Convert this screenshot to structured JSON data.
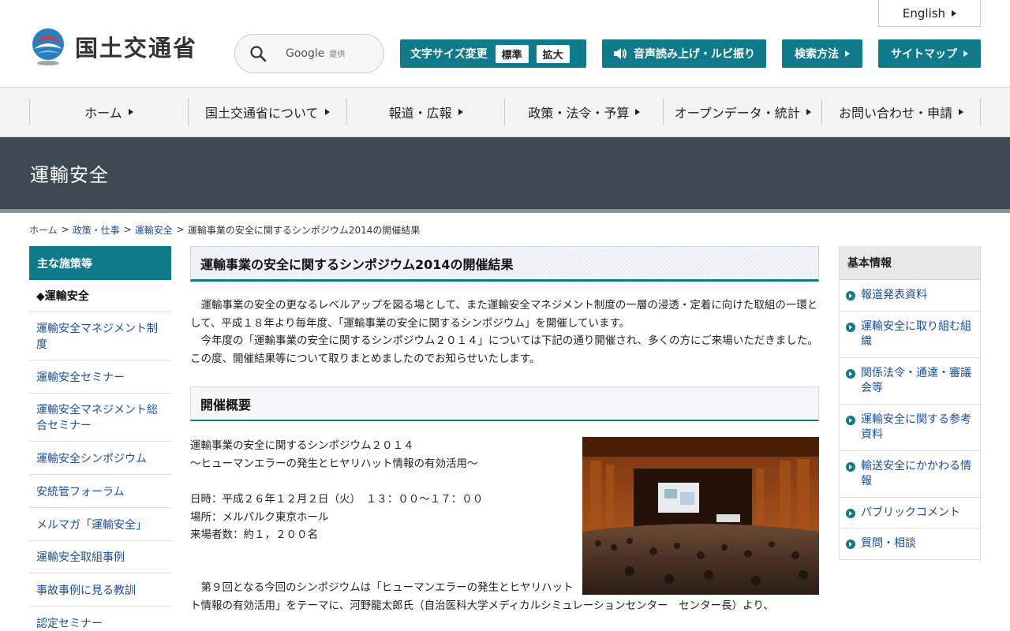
{
  "header": {
    "logo_text": "国土交通省",
    "search": {
      "brand": "Google",
      "brand_note": "提供"
    },
    "english_label": "English",
    "font_size": {
      "label": "文字サイズ変更",
      "standard": "標準",
      "large": "拡大"
    },
    "voice_label": "音声読み上げ・ルビ振り",
    "search_method_label": "検索方法",
    "sitemap_label": "サイトマップ",
    "accent_color": "#0e7a8a"
  },
  "gnav": [
    {
      "label": "ホーム"
    },
    {
      "label": "国土交通省について"
    },
    {
      "label": "報道・広報"
    },
    {
      "label": "政策・法令・予算"
    },
    {
      "label": "オープンデータ・統計"
    },
    {
      "label": "お問い合わせ・申請"
    }
  ],
  "page_title": "運輸安全",
  "breadcrumb": [
    {
      "label": "ホーム"
    },
    {
      "label": "政策・仕事"
    },
    {
      "label": "運輸安全"
    },
    {
      "label": "運輸事業の安全に関するシンポジウム2014の開催結果"
    }
  ],
  "lside": {
    "heading": "主な施策等",
    "current": "◆運輸安全",
    "items": [
      {
        "label": "運輸安全マネジメント制度"
      },
      {
        "label": "運輸安全セミナー"
      },
      {
        "label": "運輸安全マネジメント総合セミナー"
      },
      {
        "label": "運輸安全シンポジウム"
      },
      {
        "label": "安統管フォーラム"
      },
      {
        "label": "メルマガ「運輸安全」"
      },
      {
        "label": "運輸安全取組事例"
      },
      {
        "label": "事故事例に見る教訓"
      },
      {
        "label": "認定セミナー"
      }
    ]
  },
  "content": {
    "heading": "運輸事業の安全に関するシンポジウム2014の開催結果",
    "intro_lines": [
      "　運輸事業の安全の更なるレベルアップを図る場として、また運輸安全マネジメント制度の一層の浸透・定着に向けた取組の一環として、平成１８年より毎年度、「運輸事業の安全に関するシンポジウム」を開催しています。",
      "　今年度の「運輸事業の安全に関するシンポジウム２０１４」については下記の通り開催され、多くの方にご来場いただきました。",
      "この度、開催結果等について取りまとめましたのでお知らせいたします。"
    ],
    "section_heading": "開催概要",
    "event": {
      "name": "運輸事業の安全に関するシンポジウム２０１４",
      "subtitle": "～ヒューマンエラーの発生とヒヤリハット情報の有効活用～",
      "date": "日時：平成２６年１２月２日（火）　１３：００～１７：００",
      "place": "場所：メルパルク東京ホール",
      "attendance": "来場者数：約１，２００名"
    },
    "after_lines": [
      "　第９回となる今回のシンポジウムは「ヒューマンエラーの発生とヒヤリハット",
      "ト情報の有効活用」をテーマに、河野龍太郎氏（自治医科大学メディカルシミュレーションセンター　センター長）より、"
    ]
  },
  "rside": {
    "heading": "基本情報",
    "items": [
      {
        "label": "報道発表資料"
      },
      {
        "label": "運輸安全に取り組む組織"
      },
      {
        "label": "関係法令・通達・審議会等"
      },
      {
        "label": "運輸安全に関する参考資料"
      },
      {
        "label": "輸送安全にかかわる情報"
      },
      {
        "label": "パブリックコメント"
      },
      {
        "label": "質問・相談"
      }
    ]
  }
}
